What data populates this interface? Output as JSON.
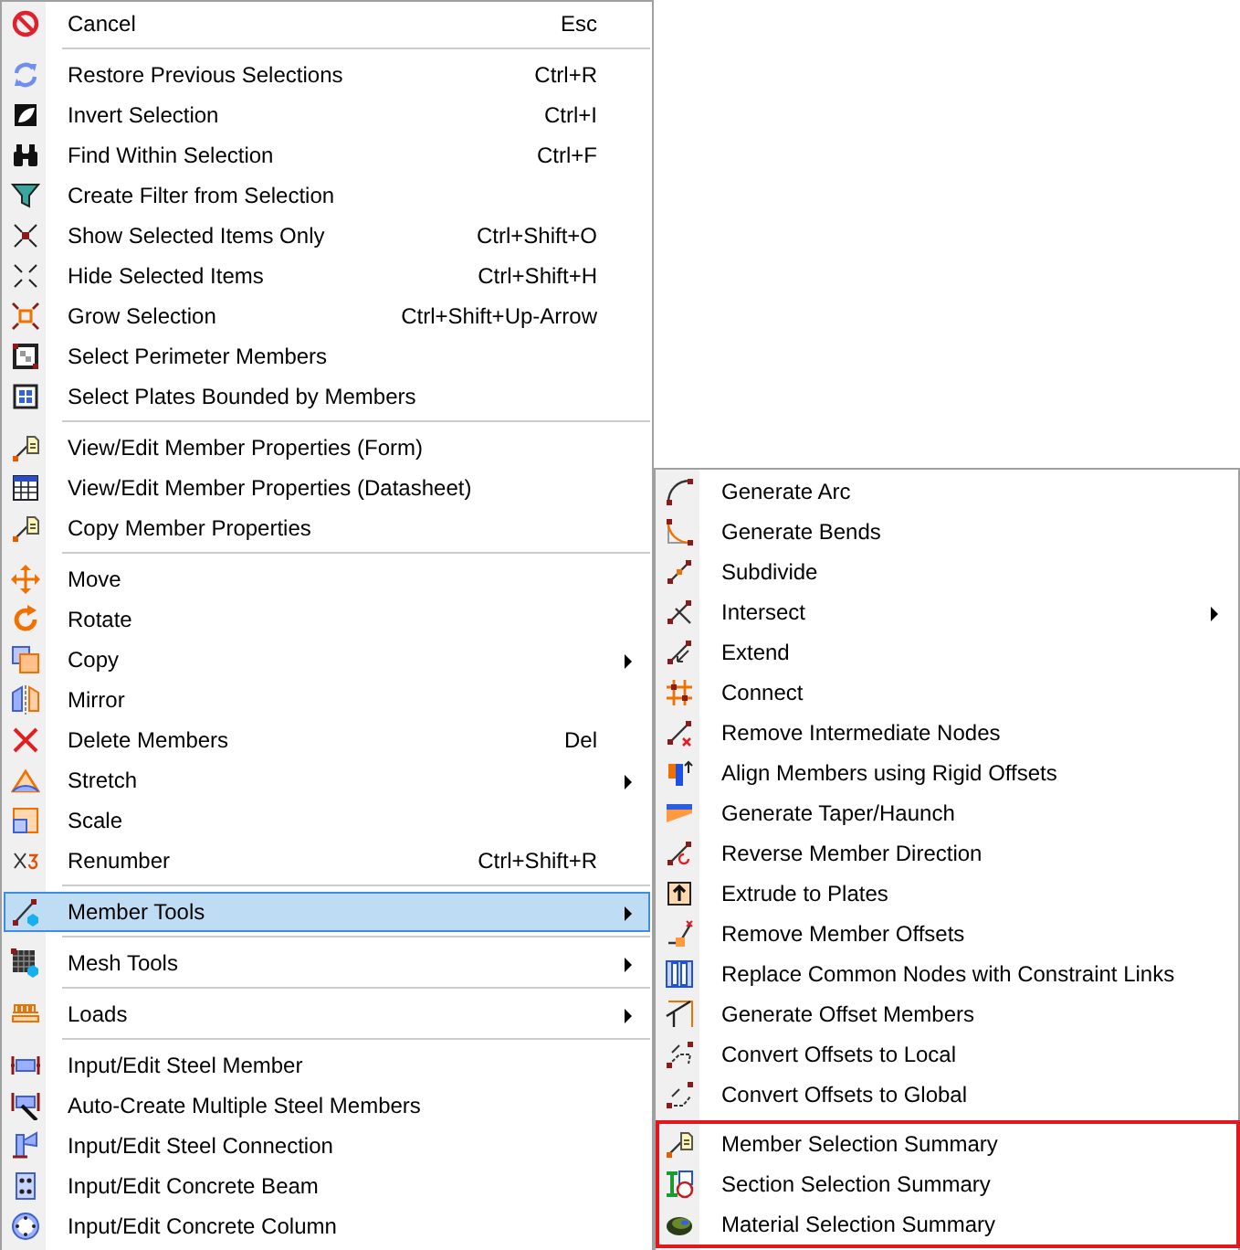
{
  "menu": {
    "sections": [
      {
        "items": [
          {
            "label": "Cancel",
            "shortcut": "Esc",
            "submenu": false,
            "selected": false
          }
        ]
      },
      {
        "items": [
          {
            "label": "Restore Previous Selections",
            "shortcut": "Ctrl+R",
            "submenu": false,
            "selected": false
          },
          {
            "label": "Invert Selection",
            "shortcut": "Ctrl+I",
            "submenu": false,
            "selected": false
          },
          {
            "label": "Find Within Selection",
            "shortcut": "Ctrl+F",
            "submenu": false,
            "selected": false
          },
          {
            "label": "Create Filter from Selection",
            "submenu": false,
            "selected": false
          },
          {
            "label": "Show Selected Items Only",
            "shortcut": "Ctrl+Shift+O",
            "submenu": false,
            "selected": false
          },
          {
            "label": "Hide Selected Items",
            "shortcut": "Ctrl+Shift+H",
            "submenu": false,
            "selected": false
          },
          {
            "label": "Grow Selection",
            "shortcut": "Ctrl+Shift+Up-Arrow",
            "submenu": false,
            "selected": false
          },
          {
            "label": "Select Perimeter Members",
            "submenu": false,
            "selected": false
          },
          {
            "label": "Select Plates Bounded by Members",
            "submenu": false,
            "selected": false
          }
        ]
      },
      {
        "items": [
          {
            "label": "View/Edit Member Properties (Form)",
            "submenu": false,
            "selected": false
          },
          {
            "label": "View/Edit Member Properties (Datasheet)",
            "submenu": false,
            "selected": false
          },
          {
            "label": "Copy Member Properties",
            "submenu": false,
            "selected": false
          }
        ]
      },
      {
        "items": [
          {
            "label": "Move",
            "submenu": false,
            "selected": false
          },
          {
            "label": "Rotate",
            "submenu": false,
            "selected": false
          },
          {
            "label": "Copy",
            "submenu": true,
            "selected": false
          },
          {
            "label": "Mirror",
            "submenu": false,
            "selected": false
          },
          {
            "label": "Delete Members",
            "shortcut": "Del",
            "submenu": false,
            "selected": false
          },
          {
            "label": "Stretch",
            "submenu": true,
            "selected": false
          },
          {
            "label": "Scale",
            "submenu": false,
            "selected": false
          },
          {
            "label": "Renumber",
            "shortcut": "Ctrl+Shift+R",
            "submenu": false,
            "selected": false
          }
        ]
      },
      {
        "items": [
          {
            "label": "Member Tools",
            "submenu": true,
            "selected": true
          }
        ]
      },
      {
        "items": [
          {
            "label": "Mesh Tools",
            "submenu": true,
            "selected": false
          }
        ]
      },
      {
        "items": [
          {
            "label": "Loads",
            "submenu": true,
            "selected": false
          }
        ]
      },
      {
        "items": [
          {
            "label": "Input/Edit Steel Member",
            "submenu": false,
            "selected": false
          },
          {
            "label": "Auto-Create Multiple Steel Members",
            "submenu": false,
            "selected": false
          },
          {
            "label": "Input/Edit Steel Connection",
            "submenu": false,
            "selected": false
          },
          {
            "label": "Input/Edit Concrete Beam",
            "submenu": false,
            "selected": false
          },
          {
            "label": "Input/Edit Concrete Column",
            "submenu": false,
            "selected": false
          }
        ]
      }
    ]
  },
  "submenu": {
    "sections": [
      {
        "outlined": false,
        "items": [
          {
            "label": "Generate Arc",
            "submenu": false,
            "selected": false
          },
          {
            "label": "Generate Bends",
            "submenu": false,
            "selected": false
          },
          {
            "label": "Subdivide",
            "submenu": false,
            "selected": false
          },
          {
            "label": "Intersect",
            "submenu": true,
            "selected": false
          },
          {
            "label": "Extend",
            "submenu": false,
            "selected": false
          },
          {
            "label": "Connect",
            "submenu": false,
            "selected": false
          },
          {
            "label": "Remove Intermediate Nodes",
            "submenu": false,
            "selected": false
          },
          {
            "label": "Align Members using Rigid Offsets",
            "submenu": false,
            "selected": false
          },
          {
            "label": "Generate Taper/Haunch",
            "submenu": false,
            "selected": false
          },
          {
            "label": "Reverse Member Direction",
            "submenu": false,
            "selected": false
          },
          {
            "label": "Extrude to Plates",
            "submenu": false,
            "selected": false
          },
          {
            "label": "Remove Member Offsets",
            "submenu": false,
            "selected": false
          },
          {
            "label": "Replace Common Nodes with Constraint Links",
            "submenu": false,
            "selected": false
          },
          {
            "label": "Generate Offset Members",
            "submenu": false,
            "selected": false
          },
          {
            "label": "Convert Offsets to Local",
            "submenu": false,
            "selected": false
          },
          {
            "label": "Convert Offsets to Global",
            "submenu": false,
            "selected": false
          }
        ]
      },
      {
        "outlined": true,
        "items": [
          {
            "label": "Member Selection Summary",
            "submenu": false,
            "selected": false
          },
          {
            "label": "Section Selection Summary",
            "submenu": false,
            "selected": false
          },
          {
            "label": "Material Selection Summary",
            "submenu": false,
            "selected": false
          }
        ]
      }
    ]
  }
}
